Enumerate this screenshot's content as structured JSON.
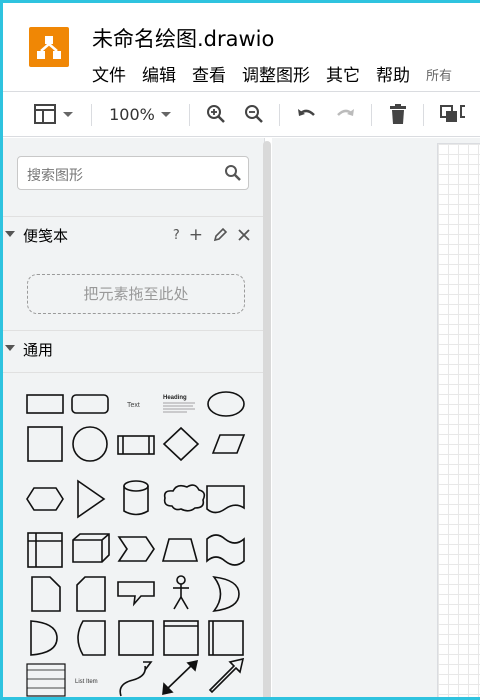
{
  "app": {
    "title": "未命名绘图.drawio",
    "brand_color": "#f08705",
    "accent_color": "#2fc3df"
  },
  "menu": {
    "items": [
      "文件",
      "编辑",
      "查看",
      "调整图形",
      "其它",
      "帮助"
    ],
    "status_text": "所有"
  },
  "toolbar": {
    "zoom": "100%",
    "icons": [
      "format-panel-icon",
      "zoom-in-icon",
      "zoom-out-icon",
      "undo-icon",
      "redo-icon",
      "delete-icon",
      "to-front-icon"
    ]
  },
  "sidebar": {
    "search_placeholder": "搜索图形",
    "scratchpad": {
      "label": "便笺本",
      "help": "?",
      "add": "+",
      "dropzone": "把元素拖至此处"
    },
    "general": {
      "label": "通用",
      "text_shape_label": "Text",
      "heading_shape_label": "Heading",
      "list_item_label": "List Item"
    }
  }
}
